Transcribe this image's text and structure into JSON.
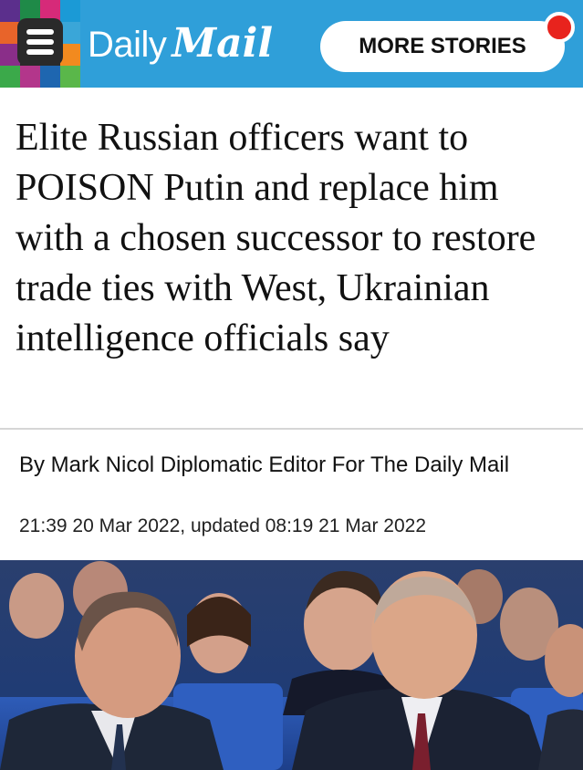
{
  "header": {
    "brand_daily": "Daily",
    "brand_mail": "Mail",
    "more_stories": "MORE STORIES",
    "logo_colors": [
      "#5b2f8c",
      "#1f8a48",
      "#d62a79",
      "#1b9ad6",
      "#e8642a",
      "#2a2a2a",
      "#2a2a2a",
      "#3aa6d8",
      "#8a2e89",
      "#2a2a2a",
      "#2a2a2a",
      "#f28a1f",
      "#3ba94a",
      "#b3368b",
      "#1e66b0",
      "#5ab74a"
    ],
    "background_color": "#2f9fd9",
    "icons": {
      "menu": "hamburger-menu-icon",
      "notification": "notification-dot-icon"
    }
  },
  "article": {
    "headline": "Elite Russian officers want to POISON Putin and replace him with a chosen successor to restore trade ties with West, Ukrainian intelligence officials say",
    "byline": "By Mark Nicol Diplomatic Editor For The Daily Mail",
    "date": "21:39 20 Mar 2022, updated 08:19 21 Mar 2022"
  }
}
